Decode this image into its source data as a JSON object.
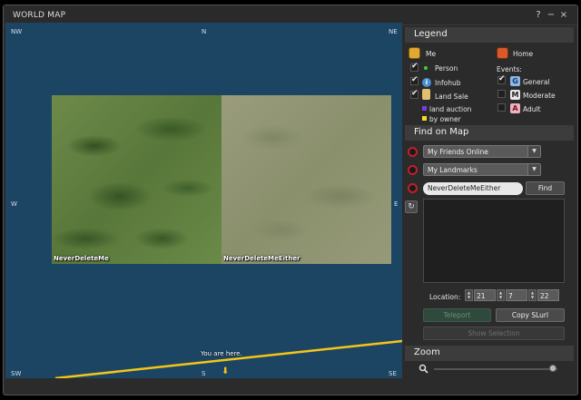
{
  "window": {
    "title": "WORLD MAP",
    "help_label": "?",
    "minimize_label": "−",
    "close_label": "×"
  },
  "map": {
    "compass": {
      "nw": "NW",
      "n": "N",
      "ne": "NE",
      "w": "W",
      "e": "E",
      "sw": "SW",
      "s": "S",
      "se": "SE"
    },
    "regions": [
      "NeverDeleteMe",
      "NeverDeleteMeEither"
    ],
    "you_are_here": "You are here.",
    "colors": {
      "water": "#1c4564",
      "track": "#f5c518"
    }
  },
  "legend": {
    "title": "Legend",
    "me": "Me",
    "home": "Home",
    "person": "Person",
    "infohub": "Infohub",
    "land_sale": "Land Sale",
    "land_auction": "land auction",
    "by_owner": "by owner",
    "events_label": "Events:",
    "general": "General",
    "moderate": "Moderate",
    "adult": "Adult",
    "badge_g": "G",
    "badge_m": "M",
    "badge_a": "A",
    "info_glyph": "i",
    "checks": {
      "person": true,
      "infohub": true,
      "land_sale": true,
      "general": true,
      "moderate": false,
      "adult": false
    }
  },
  "find": {
    "title": "Find on Map",
    "friends_dropdown": "My Friends Online",
    "landmarks_dropdown": "My Landmarks",
    "search_value": "NeverDeleteMeEither",
    "find_button": "Find",
    "location_label": "Location:",
    "x": "21",
    "y": "7",
    "z": "22",
    "teleport_button": "Teleport",
    "copy_slurl_button": "Copy SLurl",
    "show_selection_button": "Show Selection"
  },
  "zoom": {
    "title": "Zoom",
    "level": 0.96
  }
}
